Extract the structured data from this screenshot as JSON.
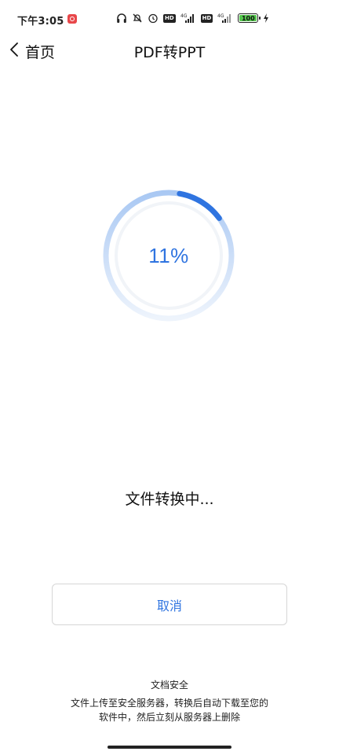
{
  "status_bar": {
    "time": "下午3:05",
    "battery_level": "100",
    "network_label": "4G",
    "hd_label": "HD",
    "battery_color": "#56c94f"
  },
  "nav": {
    "back_label": "首页",
    "title": "PDF转PPT"
  },
  "progress": {
    "percent": 11,
    "display": "11%",
    "accent_color": "#2f74e0"
  },
  "status_message": "文件转换中...",
  "cancel_label": "取消",
  "security": {
    "title": "文档安全",
    "line1": "文件上传至安全服务器，转换后自动下载至您的",
    "line2": "软件中，然后立刻从服务器上删除"
  }
}
